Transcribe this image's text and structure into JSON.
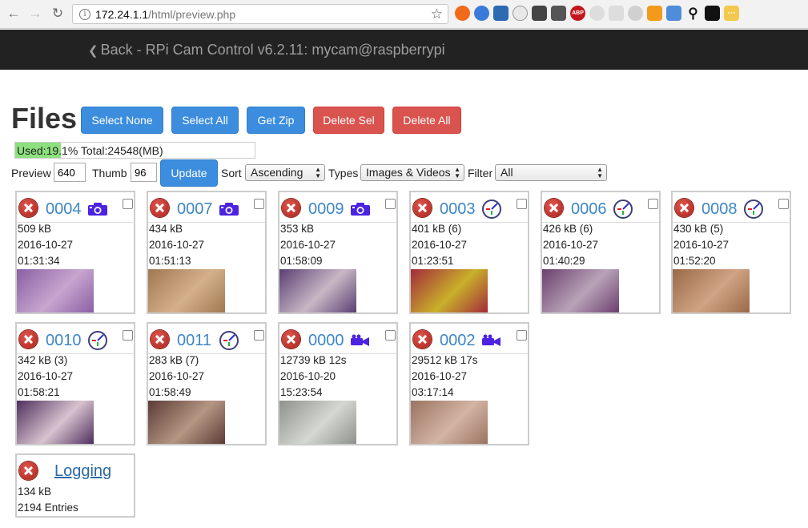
{
  "browser": {
    "url_host": "172.24.1.1",
    "url_path": "/html/preview.php"
  },
  "navbar": {
    "back_label": "Back",
    "title": "- RPi Cam Control v6.2.11: mycam@raspberrypi"
  },
  "page": {
    "title": "Files",
    "buttons": {
      "select_none": "Select None",
      "select_all": "Select All",
      "get_zip": "Get Zip",
      "delete_sel": "Delete Sel",
      "delete_all": "Delete All"
    },
    "usage": {
      "text": "Used:19.1% Total:24548(MB)",
      "used_percent": 19.1
    },
    "controls": {
      "preview_label": "Preview",
      "preview_value": "640",
      "thumb_label": "Thumb",
      "thumb_value": "96",
      "update_button": "Update",
      "sort_label": "Sort",
      "sort_value": "Ascending",
      "types_label": "Types",
      "types_value": "Images & Videos",
      "filter_label": "Filter",
      "filter_value": "All"
    }
  },
  "cards": [
    {
      "name": "0004",
      "type": "camera-icon",
      "size": "509 kB",
      "date": "2016-10-27",
      "time": "01:31:34",
      "thumb_colors": [
        "#8a5fa3",
        "#c6a6cf"
      ]
    },
    {
      "name": "0007",
      "type": "camera-icon",
      "size": "434 kB",
      "date": "2016-10-27",
      "time": "01:51:13",
      "thumb_colors": [
        "#a07851",
        "#d4b08a"
      ]
    },
    {
      "name": "0009",
      "type": "camera-icon",
      "size": "353 kB",
      "date": "2016-10-27",
      "time": "01:58:09",
      "thumb_colors": [
        "#5a3f73",
        "#c9b7c5"
      ]
    },
    {
      "name": "0003",
      "type": "timelapse-icon",
      "size": "401 kB (6)",
      "date": "2016-10-27",
      "time": "01:23:51",
      "thumb_colors": [
        "#a32a3a",
        "#c9b02a"
      ]
    },
    {
      "name": "0006",
      "type": "timelapse-icon",
      "size": "426 kB (6)",
      "date": "2016-10-27",
      "time": "01:40:29",
      "thumb_colors": [
        "#6b3f6e",
        "#b9a3b8"
      ]
    },
    {
      "name": "0008",
      "type": "timelapse-icon",
      "size": "430 kB (5)",
      "date": "2016-10-27",
      "time": "01:52:20",
      "thumb_colors": [
        "#9a6a48",
        "#cfa383"
      ]
    },
    {
      "name": "0010",
      "type": "timelapse-icon",
      "size": "342 kB (3)",
      "date": "2016-10-27",
      "time": "01:58:21",
      "thumb_colors": [
        "#4e2f5d",
        "#d8c3cf"
      ]
    },
    {
      "name": "0011",
      "type": "timelapse-icon",
      "size": "283 kB (7)",
      "date": "2016-10-27",
      "time": "01:58:49",
      "thumb_colors": [
        "#5b3b36",
        "#b59683"
      ]
    },
    {
      "name": "0000",
      "type": "video-icon",
      "size": "12739 kB 12s",
      "date": "2016-10-20",
      "time": "15:23:54",
      "thumb_colors": [
        "#8f928c",
        "#d5d8d2"
      ]
    },
    {
      "name": "0002",
      "type": "video-icon",
      "size": "29512 kB 17s",
      "date": "2016-10-27",
      "time": "03:17:14",
      "thumb_colors": [
        "#9a7361",
        "#d3b3a2"
      ]
    }
  ],
  "log_card": {
    "name": "Logging",
    "size": "134 kB",
    "entries": "2194 Entries"
  },
  "colors": {
    "primary": "#3c8dde",
    "danger": "#d9534f",
    "link": "#3c86c6",
    "navbar": "#222222",
    "usage_fill": "#8ce07e"
  }
}
